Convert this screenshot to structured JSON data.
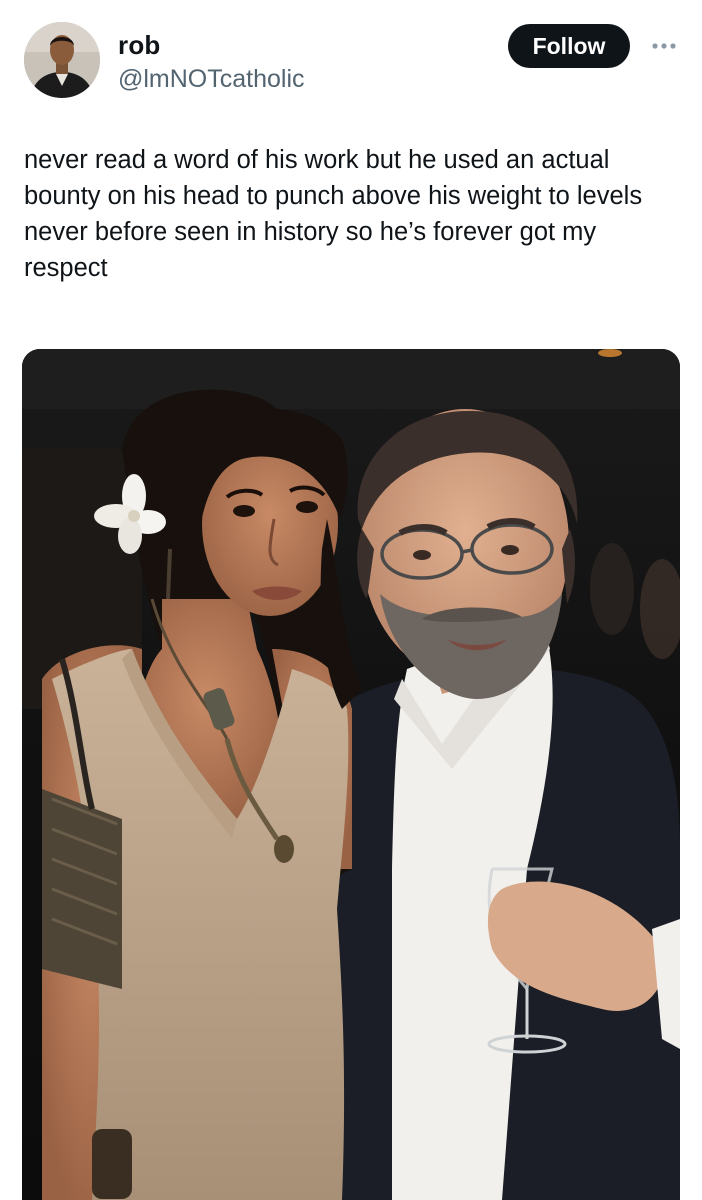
{
  "tweet": {
    "author": {
      "display_name": "rob",
      "handle": "@lmNOTcatholic"
    },
    "follow_label": "Follow",
    "more_icon": "more-horizontal-icon",
    "text": "never read a word of his work but he used an actual bounty on his head to punch above his weight to levels never before seen in history so he’s forever got my respect"
  },
  "colors": {
    "text_primary": "#0f1419",
    "text_secondary": "#536471",
    "follow_bg": "#0f1419",
    "follow_fg": "#ffffff"
  }
}
